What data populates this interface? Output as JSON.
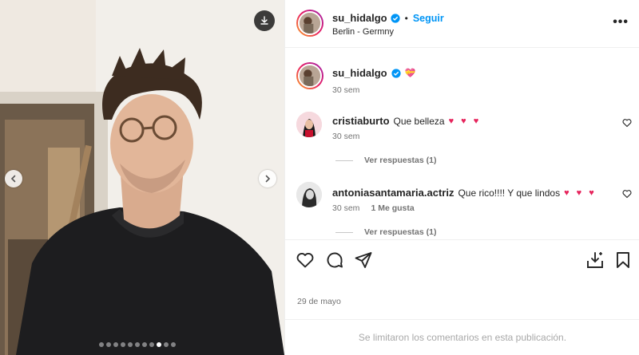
{
  "header": {
    "username": "su_hidalgo",
    "bullet": "•",
    "follow_label": "Seguir",
    "location": "Berlin - Germny",
    "more_label": "•••"
  },
  "caption": {
    "username": "su_hidalgo",
    "emoji": "💝",
    "time": "30 sem"
  },
  "comments": [
    {
      "username": "cristiaburto",
      "text": "Que belleza",
      "hearts": "♥ ♥ ♥",
      "time": "30 sem",
      "likes": "",
      "replies": "Ver respuestas (1)"
    },
    {
      "username": "antoniasantamaria.actriz",
      "text": "Que rico!!!! Y que lindos",
      "hearts": "♥ ♥ ♥",
      "time": "30 sem",
      "likes": "1 Me gusta",
      "replies": "Ver respuestas (1)"
    }
  ],
  "post": {
    "date": "29 de mayo",
    "comments_disabled": "Se limitaron los comentarios en esta publicación."
  },
  "carousel": {
    "count": 11,
    "active_index": 8
  },
  "icons": {
    "download": "download-icon",
    "prev": "chevron-left-icon",
    "next": "chevron-right-icon",
    "verified": "verified-badge-icon",
    "like": "heart-icon",
    "comment": "comment-icon",
    "share": "send-icon",
    "save_to": "save-to-collection-icon",
    "bookmark": "bookmark-icon"
  },
  "colors": {
    "link": "#0095f6",
    "verified": "#0095f6",
    "heart": "#e6245c"
  }
}
